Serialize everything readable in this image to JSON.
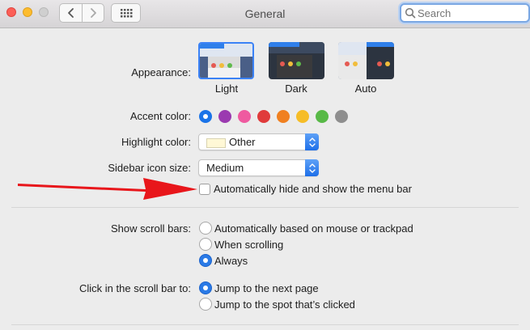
{
  "window": {
    "title": "General"
  },
  "search": {
    "placeholder": "Search",
    "value": ""
  },
  "appearance": {
    "label": "Appearance:",
    "options": [
      "Light",
      "Dark",
      "Auto"
    ],
    "selected": "Light"
  },
  "accent": {
    "label": "Accent color:",
    "colors": [
      "#1a73e8",
      "#9b3ab0",
      "#ef5aa0",
      "#e03b3b",
      "#f08020",
      "#f6bd27",
      "#58b947",
      "#8e8e8e"
    ],
    "selected_index": 0
  },
  "highlight": {
    "label": "Highlight color:",
    "value": "Other",
    "swatch_color": "#fff8d6"
  },
  "sidebar_size": {
    "label": "Sidebar icon size:",
    "value": "Medium"
  },
  "menubar": {
    "label": "Automatically hide and show the menu bar",
    "checked": false
  },
  "scrollbars": {
    "label": "Show scroll bars:",
    "options": [
      "Automatically based on mouse or trackpad",
      "When scrolling",
      "Always"
    ],
    "selected": "Always"
  },
  "scroll_click": {
    "label": "Click in the scroll bar to:",
    "options": [
      "Jump to the next page",
      "Jump to the spot that’s clicked"
    ],
    "selected": "Jump to the next page"
  },
  "annotation": {
    "arrow_color": "#e8161b"
  }
}
